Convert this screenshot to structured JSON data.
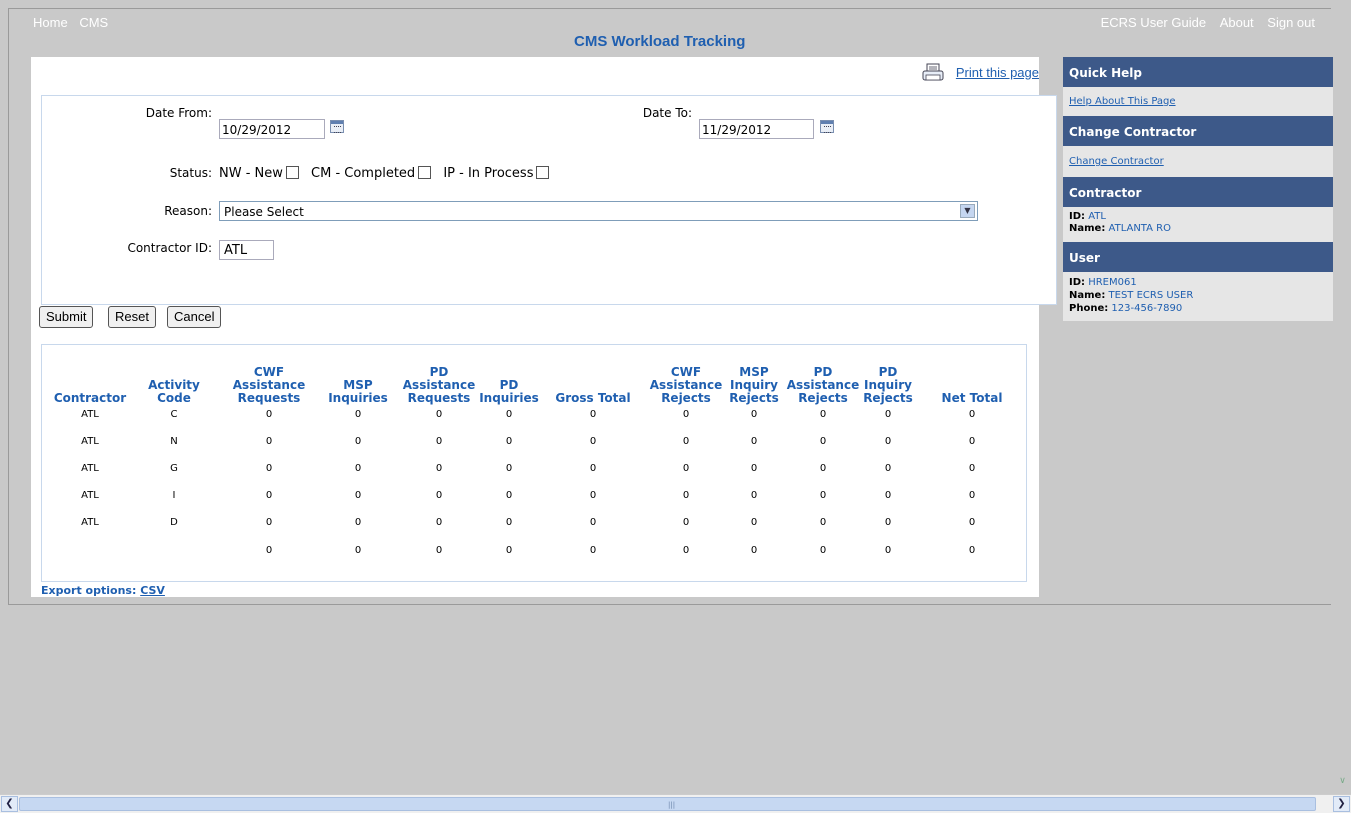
{
  "topnav": {
    "left": [
      "Home",
      "CMS"
    ],
    "right": [
      "ECRS User Guide",
      "About",
      "Sign out"
    ]
  },
  "page_title": "CMS Workload Tracking",
  "print_label": "Print this page",
  "form": {
    "date_from_label": "Date From:",
    "date_from_value": "10/29/2012",
    "date_to_label": "Date To:",
    "date_to_value": "11/29/2012",
    "status_label": "Status:",
    "status_options": [
      "NW - New",
      "CM - Completed",
      "IP - In Process"
    ],
    "reason_label": "Reason:",
    "reason_value": "Please Select",
    "contractor_label": "Contractor ID:",
    "contractor_value": "ATL"
  },
  "buttons": {
    "submit": "Submit",
    "reset": "Reset",
    "cancel": "Cancel"
  },
  "table": {
    "headers": [
      [
        "Contractor"
      ],
      [
        "Activity",
        "Code"
      ],
      [
        "CWF",
        "Assistance",
        "Requests"
      ],
      [
        "MSP",
        "Inquiries"
      ],
      [
        "PD",
        "Assistance",
        "Requests"
      ],
      [
        "PD",
        "Inquiries"
      ],
      [
        "Gross Total"
      ],
      [
        "CWF",
        "Assistance",
        "Rejects"
      ],
      [
        "MSP",
        "Inquiry",
        "Rejects"
      ],
      [
        "PD",
        "Assistance",
        "Rejects"
      ],
      [
        "PD",
        "Inquiry",
        "Rejects"
      ],
      [
        "Net Total"
      ]
    ],
    "rows": [
      [
        "ATL",
        "C",
        "0",
        "0",
        "0",
        "0",
        "0",
        "0",
        "0",
        "0",
        "0",
        "0"
      ],
      [
        "ATL",
        "N",
        "0",
        "0",
        "0",
        "0",
        "0",
        "0",
        "0",
        "0",
        "0",
        "0"
      ],
      [
        "ATL",
        "G",
        "0",
        "0",
        "0",
        "0",
        "0",
        "0",
        "0",
        "0",
        "0",
        "0"
      ],
      [
        "ATL",
        "I",
        "0",
        "0",
        "0",
        "0",
        "0",
        "0",
        "0",
        "0",
        "0",
        "0"
      ],
      [
        "ATL",
        "D",
        "0",
        "0",
        "0",
        "0",
        "0",
        "0",
        "0",
        "0",
        "0",
        "0"
      ],
      [
        "",
        "",
        "0",
        "0",
        "0",
        "0",
        "0",
        "0",
        "0",
        "0",
        "0",
        "0"
      ]
    ]
  },
  "export": {
    "label": "Export options:",
    "csv": "CSV"
  },
  "sidebar": {
    "quick_help_title": "Quick Help",
    "quick_help_link": "Help About This Page",
    "change_contractor_title": "Change Contractor",
    "change_contractor_link": "Change Contractor",
    "contractor_title": "Contractor",
    "contractor_id_label": "ID:",
    "contractor_id": "ATL",
    "contractor_name_label": "Name:",
    "contractor_name": "ATLANTA RO",
    "user_title": "User",
    "user_id_label": "ID:",
    "user_id": "HREM061",
    "user_name_label": "Name:",
    "user_name": "TEST ECRS USER",
    "user_phone_label": "Phone:",
    "user_phone": "123-456-7890"
  },
  "colors": {
    "accent": "#1f5fb0",
    "sidebar_header": "#3d5989",
    "background": "#c9c9c9"
  }
}
